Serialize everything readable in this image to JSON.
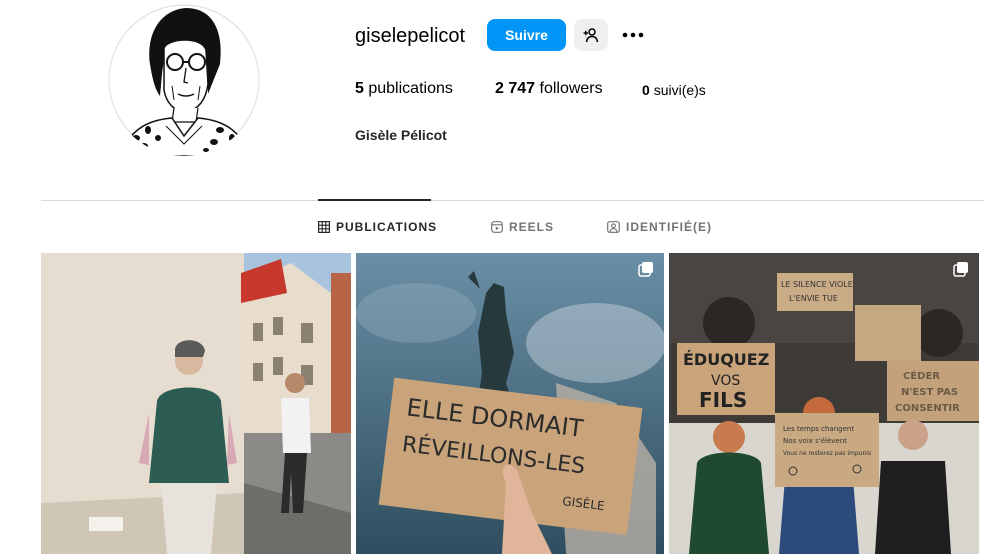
{
  "profile": {
    "username": "giselepelicot",
    "follow_label": "Suivre",
    "suggest_icon": "person-plus-icon",
    "more_icon": "more-horizontal-icon",
    "display_name": "Gisèle Pélicot"
  },
  "stats": {
    "publications_count": "5",
    "publications_label": "publications",
    "followers_count": "2 747",
    "followers_label": "followers",
    "following_count": "0",
    "following_label": "suivi(e)s"
  },
  "tabs": [
    {
      "label": "PUBLICATIONS",
      "icon": "grid-icon",
      "active": true
    },
    {
      "label": "REELS",
      "icon": "reels-icon",
      "active": false
    },
    {
      "label": "IDENTIFIÉ(E)",
      "icon": "tagged-icon",
      "active": false
    }
  ],
  "posts": [
    {
      "signs": []
    },
    {
      "signs": [
        "ELLE DORMAIT",
        "RÉVEILLONS-LES",
        "GISÈLE"
      ]
    },
    {
      "signs": [
        "ÉDUQUEZ",
        "VOS",
        "FILS",
        "LE SILENCE VIOLE",
        "L'ENVIE TUE",
        "Les temps changent",
        "Nos voix s'élèvent",
        "Vous ne resterez pas impunis",
        "CÉDER",
        "N'EST PAS",
        "CONSENTIR"
      ]
    }
  ],
  "colors": {
    "accent": "#0095f6",
    "divider": "#dbdbdb"
  }
}
